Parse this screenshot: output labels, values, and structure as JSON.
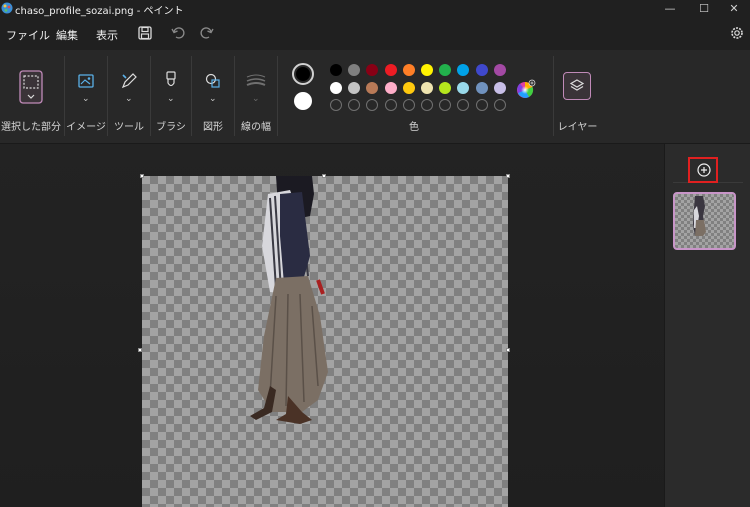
{
  "window": {
    "title": "chaso_profile_sozai.png - ペイント",
    "minimize_glyph": "—",
    "maximize_glyph": "☐",
    "close_glyph": "✕"
  },
  "menu": {
    "file": "ファイル",
    "edit": "編集",
    "view": "表示"
  },
  "ribbon": {
    "groups": {
      "selection": "選択した部分",
      "image": "イメージ",
      "tools": "ツール",
      "brushes": "ブラシ",
      "shapes": "図形",
      "line_width": "線の幅",
      "colors": "色",
      "layers": "レイヤー"
    },
    "primary_color": "#000000",
    "secondary_color": "#ffffff",
    "palette_row1": [
      "#000000",
      "#7f7f7f",
      "#880015",
      "#ed1c24",
      "#ff7f27",
      "#fff200",
      "#22b14c",
      "#00a2e8",
      "#3f48cc",
      "#a349a4"
    ],
    "palette_row2": [
      "#ffffff",
      "#c3c3c3",
      "#b97a57",
      "#ffaec9",
      "#ffc90e",
      "#efe4b0",
      "#b5e61d",
      "#99d9ea",
      "#7092be",
      "#c8bfe7"
    ],
    "palette_row3_slots": 10
  },
  "icons": {
    "app": "paint-app-icon",
    "save": "save-icon",
    "undo": "undo-icon",
    "redo": "redo-icon",
    "settings": "gear-icon",
    "add_layer": "plus-circle-icon"
  },
  "layers_panel": {
    "highlight_color": "#e02020",
    "selected_border": "#c895c8"
  }
}
